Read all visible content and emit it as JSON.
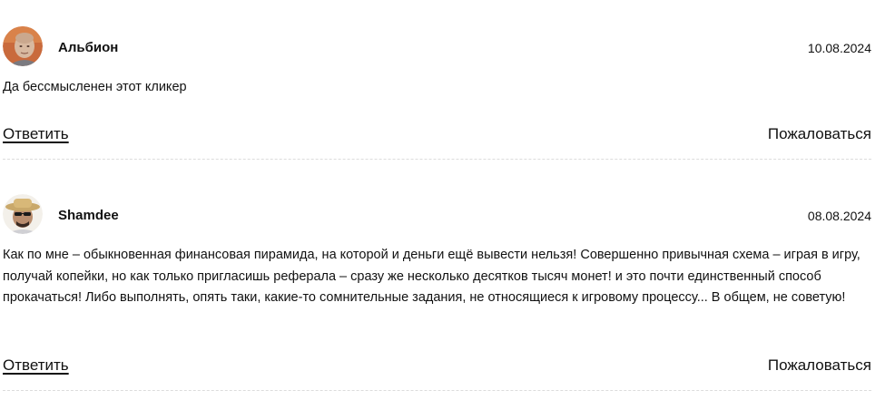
{
  "comments": [
    {
      "author": "Альбион",
      "date": "10.08.2024",
      "text": "Да бессмысленен этот кликер",
      "reply_label": "Ответить",
      "report_label": "Пожаловаться"
    },
    {
      "author": "Shamdee",
      "date": "08.08.2024",
      "text": "Как по мне – обыкновенная финансовая пирамида, на которой и деньги ещё вывести нельзя! Совершенно привычная схема – играя в игру, получай копейки, но как только пригласишь реферала – сразу же несколько десятков тысяч монет! и это почти единственный способ прокачаться! Либо выполнять, опять таки, какие-то сомнительные задания, не относящиеся к игровому процессу... В общем, не советую!",
      "reply_label": "Ответить",
      "report_label": "Пожаловаться"
    }
  ]
}
